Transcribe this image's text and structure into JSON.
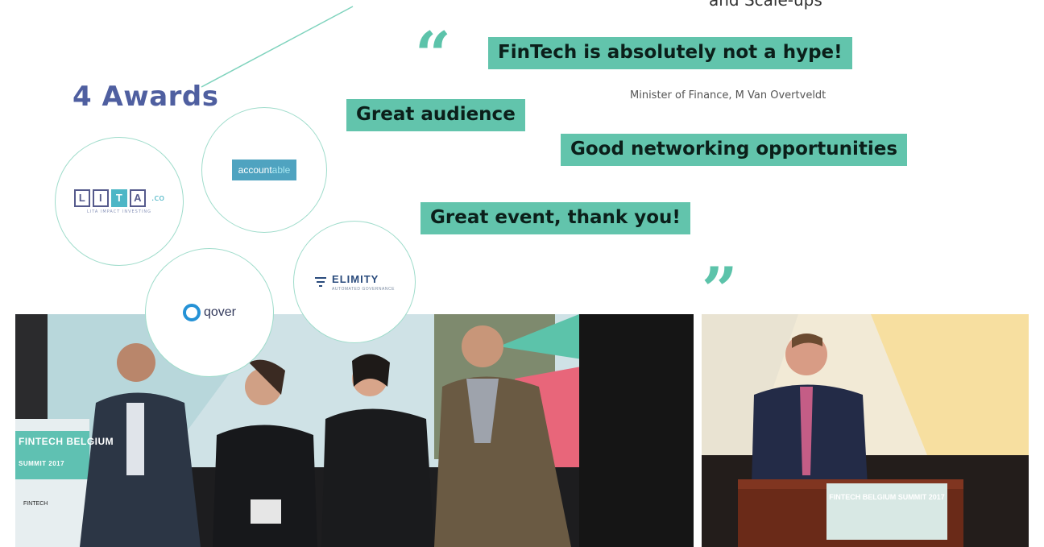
{
  "header": {
    "partial_caption": "and Scale-ups"
  },
  "awards": {
    "title": "4 Awards",
    "logos": {
      "lita_letters": [
        "L",
        "I",
        "T",
        "A"
      ],
      "lita_suffix": ".co",
      "lita_tagline": "LITA IMPACT INVESTING",
      "accountable_main": "account",
      "accountable_tail": "able",
      "qover": "qover",
      "elimity": "ELIMITY",
      "elimity_tagline": "AUTOMATED GOVERNANCE"
    }
  },
  "quotes": {
    "open_mark": "“",
    "close_mark": "“",
    "main": "FinTech is absolutely not a hype!",
    "attribution": "Minister of Finance, M Van Overtveldt",
    "q2": "Great audience",
    "q3": "Good networking opportunities",
    "q4": "Great event, thank you!"
  },
  "photos": {
    "left_banner": "FINTECH BELGIUM",
    "left_banner_sub": "SUMMIT 2017",
    "left_sponsor": "FINTECH",
    "right_podium": "FINTECH BELGIUM SUMMIT 2017"
  },
  "colors": {
    "accent_teal": "#62c4ac",
    "awards_blue": "#4f5fa0"
  }
}
